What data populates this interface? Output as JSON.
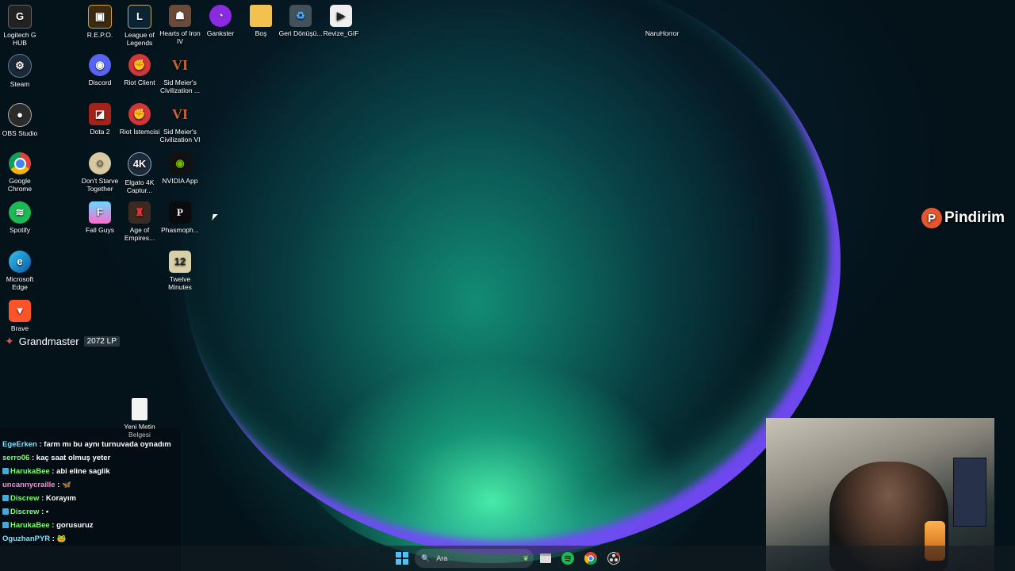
{
  "colors": {
    "accent": "#7a52ff",
    "chat_user_green": "#7fff6a",
    "chat_user_cyan": "#7fe3ff",
    "chat_user_pink": "#ff8ad8",
    "pindirim": "#e4572e"
  },
  "desktop_icons": [
    {
      "label": "Logitech G HUB",
      "icon": "logitech-icon"
    },
    {
      "label": "Steam",
      "icon": "steam-icon"
    },
    {
      "label": "OBS Studio",
      "icon": "obs-icon"
    },
    {
      "label": "Google Chrome",
      "icon": "chrome-icon"
    },
    {
      "label": "Spotify",
      "icon": "spotify-icon"
    },
    {
      "label": "Microsoft Edge",
      "icon": "edge-icon"
    },
    {
      "label": "Brave",
      "icon": "brave-icon"
    },
    {
      "label": "R.E.P.O.",
      "icon": "repo-icon"
    },
    {
      "label": "Discord",
      "icon": "discord-icon"
    },
    {
      "label": "Dota 2",
      "icon": "dota-icon"
    },
    {
      "label": "Don't Starve Together",
      "icon": "dont-starve-icon"
    },
    {
      "label": "Fall Guys",
      "icon": "fall-guys-icon"
    },
    {
      "label": "League of Legends",
      "icon": "lol-icon"
    },
    {
      "label": "Riot Client",
      "icon": "riot-icon"
    },
    {
      "label": "Riot İstemcisi",
      "icon": "riot-icon"
    },
    {
      "label": "Elgato 4K Captur...",
      "icon": "elgato-icon"
    },
    {
      "label": "Age of Empires...",
      "icon": "aoe-icon"
    },
    {
      "label": "Hearts of Iron IV",
      "icon": "hoi-icon"
    },
    {
      "label": "Sid Meier's Civilization ...",
      "icon": "civ-icon"
    },
    {
      "label": "Sid Meier's Civilization VI",
      "icon": "civ-icon"
    },
    {
      "label": "NVIDIA App",
      "icon": "nvidia-icon"
    },
    {
      "label": "Phasmoph...",
      "icon": "phasmophobia-icon"
    },
    {
      "label": "Twelve Minutes",
      "icon": "twelve-minutes-icon"
    },
    {
      "label": "Gankster",
      "icon": "gankster-icon"
    },
    {
      "label": "Boş",
      "icon": "folder-icon"
    },
    {
      "label": "Geri Dönüşü...",
      "icon": "recycle-bin-icon"
    },
    {
      "label": "Revize_GIF",
      "icon": "video-file-icon"
    },
    {
      "label": "NaruHorror",
      "icon": "blank-icon"
    },
    {
      "label": "Yeni Metin Belgesi",
      "icon": "text-file-icon"
    }
  ],
  "rank": {
    "title": "Grandmaster",
    "lp": "2072 LP"
  },
  "overlay": {
    "brand": "Pindirim",
    "logo_letter": "P"
  },
  "chat": [
    {
      "user": "EgeErken",
      "text": "farm mı bu aynı turnuvada oynadım"
    },
    {
      "user": "serro06",
      "text": "kaç saat olmuş yeter"
    },
    {
      "user": "HarukaBee",
      "text": "abi eline saglik"
    },
    {
      "user": "uncannycraille",
      "text": "🦋"
    },
    {
      "user": "Discrew",
      "text": "Korayım"
    },
    {
      "user": "Discrew",
      "text": "▪"
    },
    {
      "user": "HarukaBee",
      "text": "gorusuruz"
    },
    {
      "user": "OguzhanPYR",
      "text": "🐸"
    }
  ],
  "taskbar": {
    "search_placeholder": "Ara",
    "items": [
      "windows-start-icon",
      "search-icon",
      "widget-icon",
      "file-explorer-icon",
      "spotify-icon",
      "chrome-icon",
      "obs-icon"
    ]
  }
}
